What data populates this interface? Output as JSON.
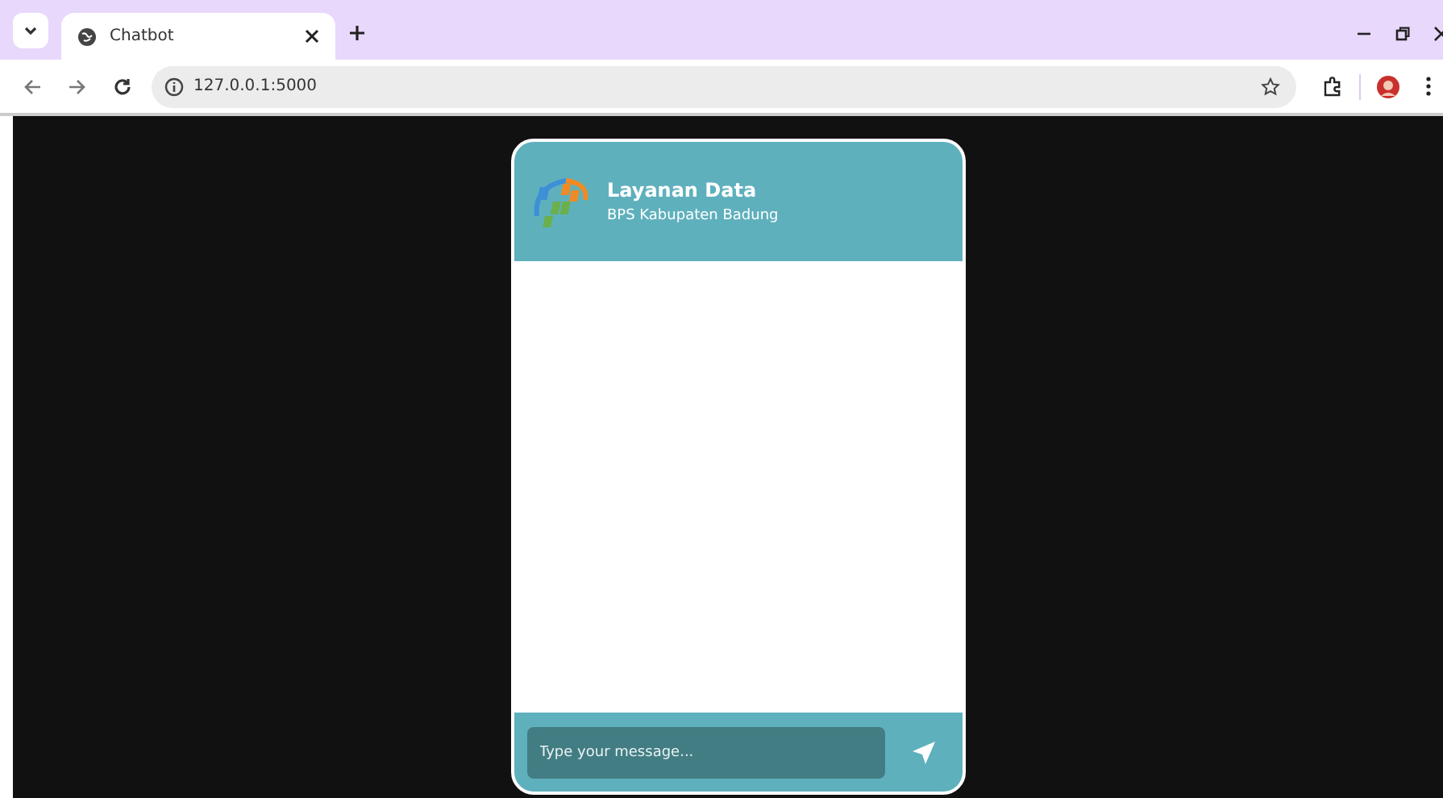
{
  "browser": {
    "tab_title": "Chatbot",
    "url": "127.0.0.1:5000"
  },
  "chat": {
    "title": "Layanan Data",
    "subtitle": "BPS Kabupaten Badung",
    "input": {
      "placeholder": "Type your message..."
    }
  }
}
